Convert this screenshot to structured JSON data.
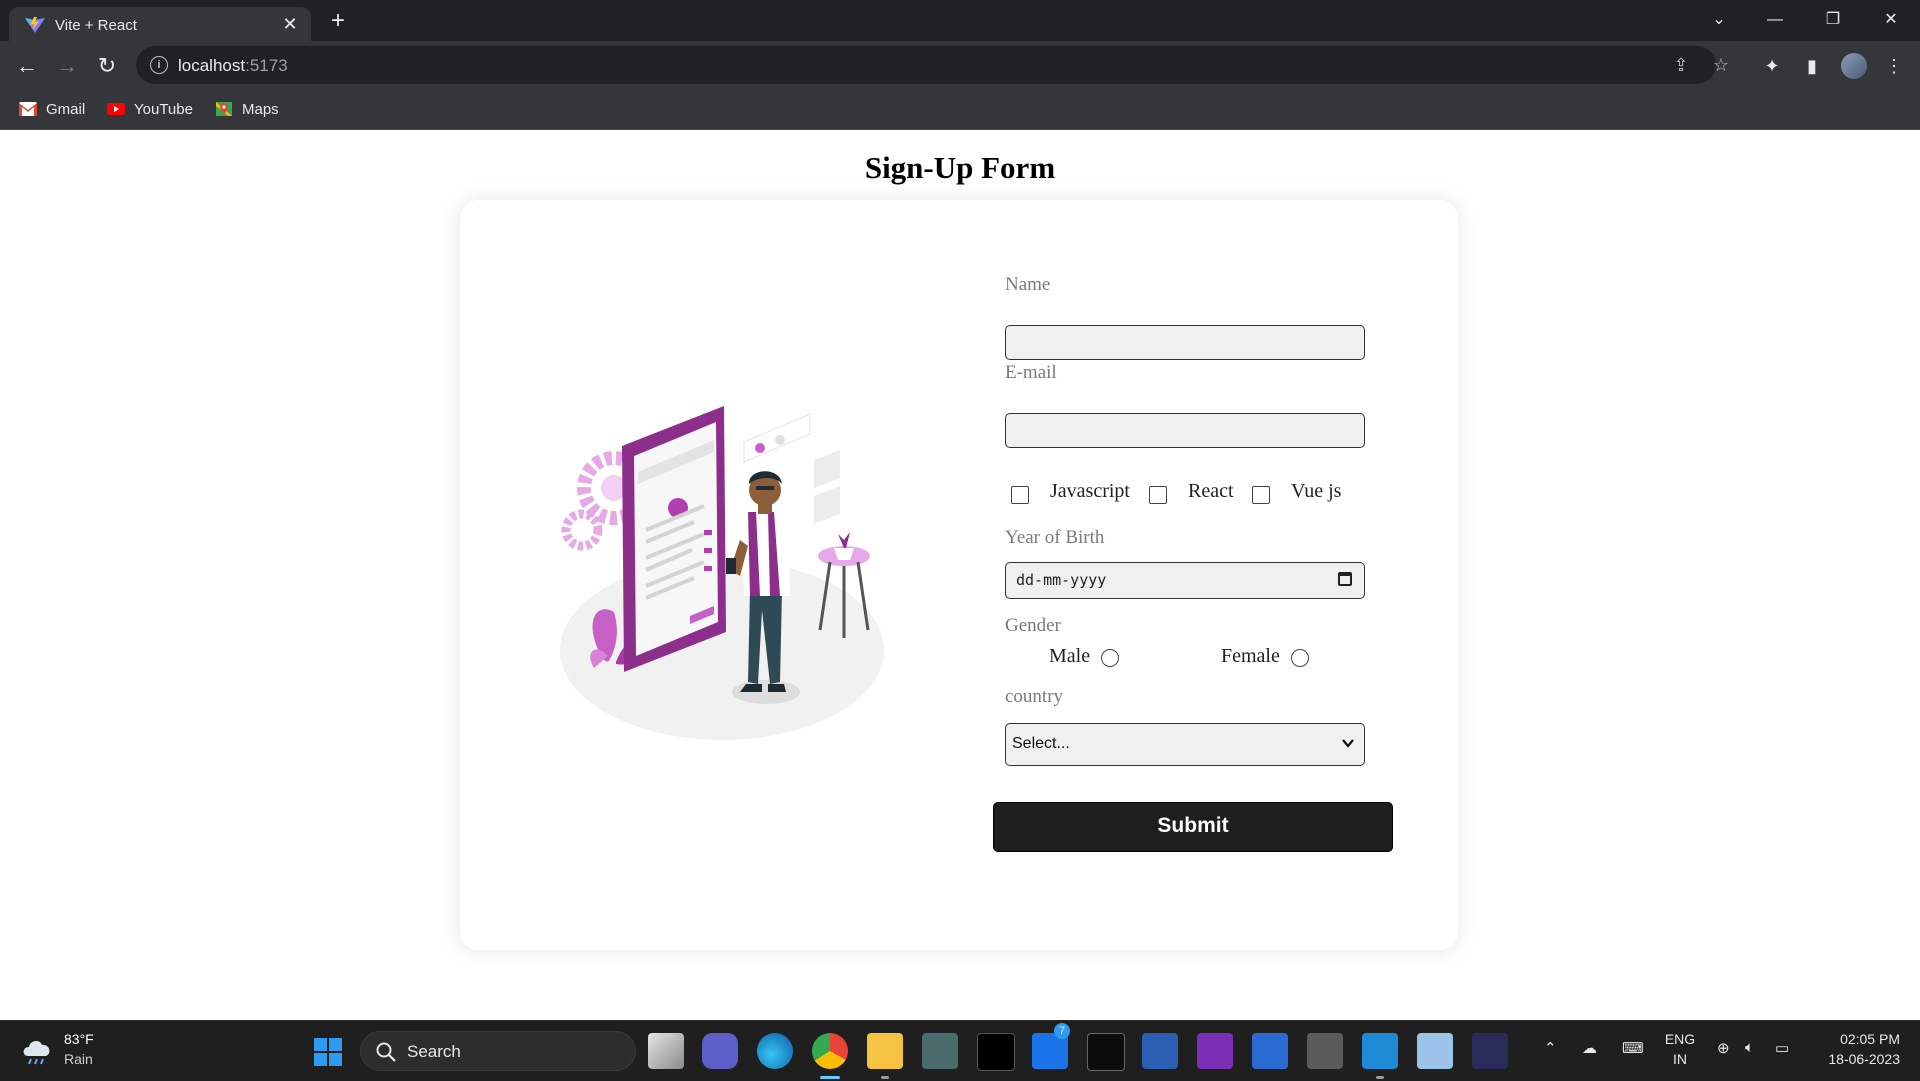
{
  "browser": {
    "tab_title": "Vite + React",
    "url_host": "localhost",
    "url_port": ":5173",
    "bookmarks": [
      {
        "label": "Gmail",
        "icon": "gmail-icon"
      },
      {
        "label": "YouTube",
        "icon": "youtube-icon"
      },
      {
        "label": "Maps",
        "icon": "maps-icon"
      }
    ]
  },
  "page": {
    "title": "Sign-Up Form"
  },
  "form": {
    "name_label": "Name",
    "name_value": "",
    "email_label": "E-mail",
    "email_value": "",
    "skills": [
      {
        "label": "Javascript",
        "checked": false
      },
      {
        "label": "React",
        "checked": false
      },
      {
        "label": "Vue js",
        "checked": false
      }
    ],
    "yob_label": "Year of Birth",
    "yob_placeholder": "dd-mm-yyyy",
    "gender_label": "Gender",
    "gender_options": [
      {
        "label": "Male",
        "selected": false
      },
      {
        "label": "Female",
        "selected": false
      }
    ],
    "country_label": "country",
    "country_selected": "Select...",
    "submit_label": "Submit"
  },
  "taskbar": {
    "weather_temp": "83°F",
    "weather_cond": "Rain",
    "search_placeholder": "Search",
    "mail_badge": "7",
    "lang_line1": "ENG",
    "lang_line2": "IN",
    "time": "02:05 PM",
    "date": "18-06-2023"
  },
  "colors": {
    "chrome_dark": "#202124",
    "chrome_toolbar": "#35363a",
    "submit_bg": "#1e1e1e",
    "illustration_accent": "#9c3d9c",
    "taskbar_bg": "#1f1f1f"
  }
}
